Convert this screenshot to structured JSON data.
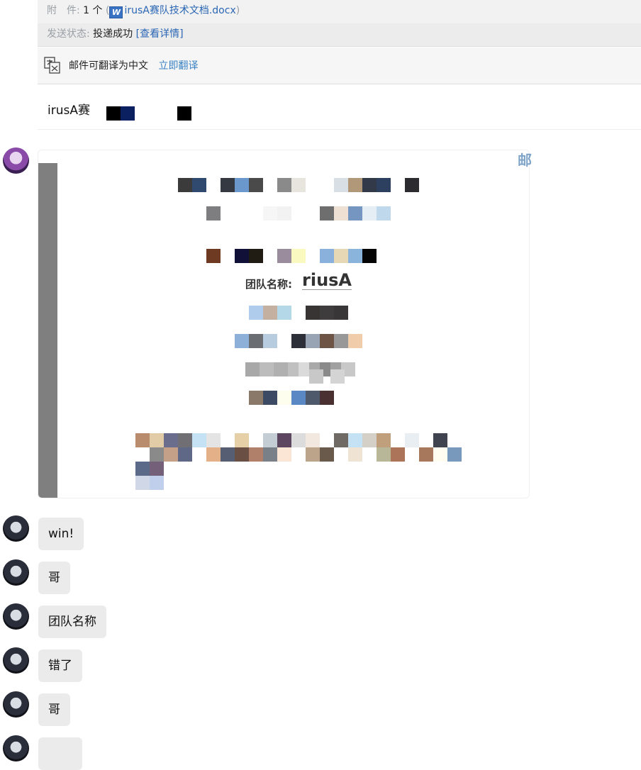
{
  "mail": {
    "attach_label": "附　件:",
    "attach_count": "1 个",
    "attach_paren_open": "(",
    "attach_icon_glyph": "W",
    "attach_filename": "irusA赛队技术文档.docx",
    "attach_paren_close": ")",
    "status_label": "发送状态:",
    "status_value": "投递成功",
    "status_link": "[查看详情]",
    "translate_text": "邮件可翻译为中文",
    "translate_link": "立即翻译",
    "body_text": "irusA赛"
  },
  "image_preview": {
    "team_label": "团队名称:",
    "team_name": "riusA",
    "side_char": "邮"
  },
  "messages": [
    {
      "text": "win!"
    },
    {
      "text": "哥"
    },
    {
      "text": "团队名称"
    },
    {
      "text": "错了"
    },
    {
      "text": "哥"
    },
    {
      "text": ""
    }
  ],
  "colors": {
    "link": "#2a66b4",
    "bubble": "#ebebeb",
    "sidebar_bar": "#7f7f7f"
  }
}
